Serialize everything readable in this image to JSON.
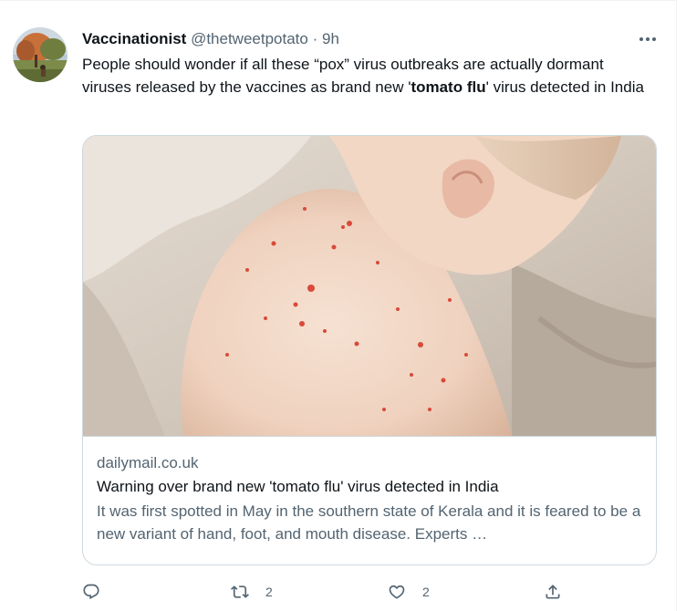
{
  "tweet": {
    "author_name": "Vaccinationist",
    "handle": "@thetweetpotato",
    "separator": "·",
    "time": "9h",
    "text_part1": "People should wonder if all these “pox” virus outbreaks are actually dormant viruses released by the vaccines as brand new '",
    "text_bold": "tomato flu",
    "text_part2": "' virus detected in India"
  },
  "card": {
    "domain": "dailymail.co.uk",
    "title": "Warning over brand new 'tomato flu' virus detected in India",
    "description": "It was first spotted in May in the southern state of Kerala and it is feared to be a new variant of hand, foot, and mouth disease. Experts …"
  },
  "actions": {
    "reply_count": "",
    "retweet_count": "2",
    "like_count": "2"
  },
  "icons": {
    "more": "more-icon",
    "reply": "reply-icon",
    "retweet": "retweet-icon",
    "like": "like-icon",
    "share": "share-icon"
  },
  "colors": {
    "text": "#0f1419",
    "secondary": "#536471",
    "border": "#cfd9de"
  }
}
